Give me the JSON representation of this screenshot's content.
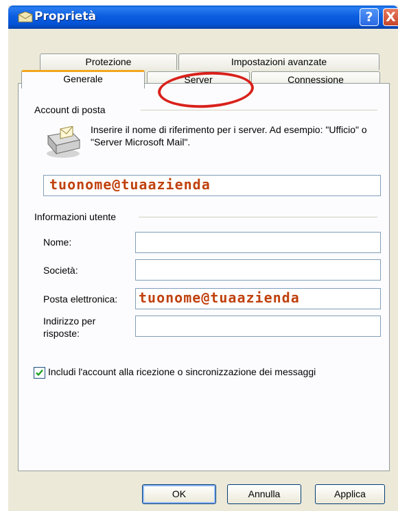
{
  "window": {
    "title": "Proprietà",
    "help_label": "?",
    "close_label": "X"
  },
  "tabs": {
    "row1": [
      {
        "label": "Protezione"
      },
      {
        "label": "Impostazioni avanzate"
      }
    ],
    "row2": [
      {
        "label": "Generale",
        "selected": true
      },
      {
        "label": "Server",
        "highlighted": true
      },
      {
        "label": "Connessione"
      }
    ]
  },
  "account_section": {
    "title": "Account di posta",
    "hint": "Inserire il nome di riferimento per i server. Ad esempio: \"Ufficio\" o \"Server Microsoft Mail\".",
    "account_name_value": "tuonome@tuaazienda",
    "icon": "mail-account-icon"
  },
  "user_section": {
    "title": "Informazioni utente",
    "name_label": "Nome:",
    "company_label": "Società:",
    "email_label": "Posta elettronica:",
    "email_value": "tuonome@tuaazienda",
    "reply_label_line1": "Indirizzo per",
    "reply_label_line2": "risposte:",
    "name_value": "",
    "company_value": "",
    "reply_value": ""
  },
  "include_checkbox": {
    "label": "Includi l'account alla ricezione o sincronizzazione dei messaggi",
    "checked": true
  },
  "buttons": {
    "ok": "OK",
    "cancel": "Annulla",
    "apply": "Applica"
  },
  "colors": {
    "titlebar": "#0553d6",
    "highlight_text": "#c0410d",
    "annotation_circle": "#d9211b",
    "selected_tab_accent": "#f3a51c"
  }
}
